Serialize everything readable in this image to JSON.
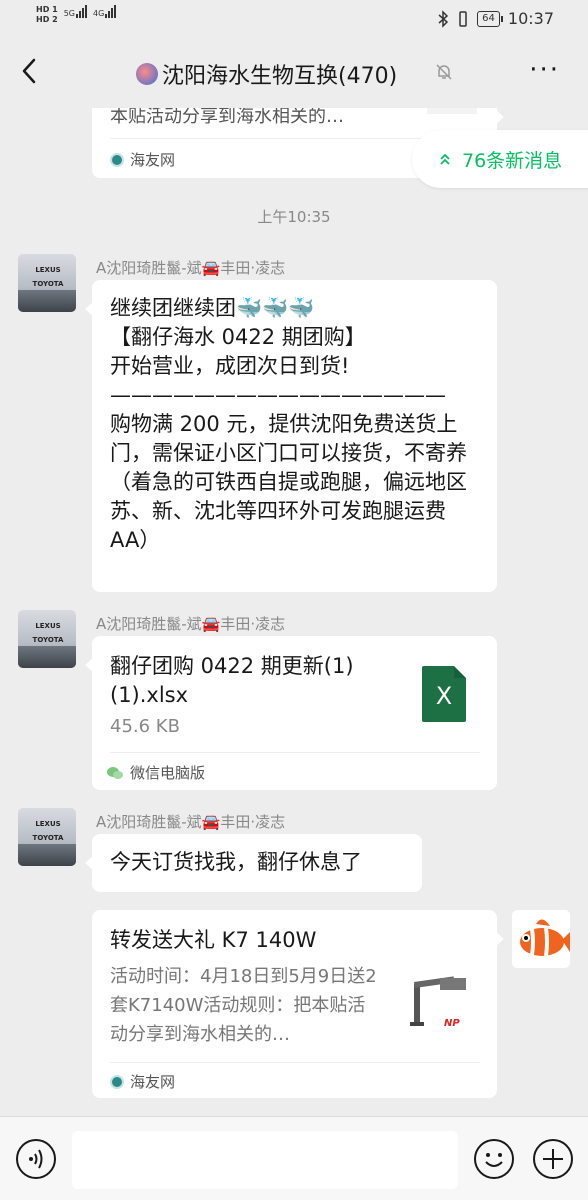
{
  "status_bar": {
    "hd1": "HD 1",
    "hd2": "HD 2",
    "net1": "5G",
    "net2": "4G",
    "battery": "64",
    "time": "10:37"
  },
  "header": {
    "title": "沈阳海水生物互换(470)",
    "more_label": "···"
  },
  "new_messages": {
    "label": "76条新消息"
  },
  "messages": [
    {
      "kind": "link-partial",
      "text": "本贴活动分享到海水相关的…",
      "source": "海友网"
    },
    {
      "kind": "time",
      "text": "上午10:35"
    },
    {
      "kind": "text",
      "sender": "A沈阳琦胜鬣-斌🚘丰田·凌志",
      "text": "继续团继续团🐳🐳🐳\n【翻仔海水 0422 期团购】\n开始营业，成团次日到货!\n————————————————\n购物满 200 元，提供沈阳免费送货上门，需保证小区门口可以接货，不寄养（着急的可铁西自提或跑腿，偏远地区苏、新、沈北等四环外可发跑腿运费 AA）"
    },
    {
      "kind": "file",
      "sender": "A沈阳琦胜鬣-斌🚘丰田·凌志",
      "filename": "翻仔团购 0422 期更新(1)(1).xlsx",
      "size": "45.6 KB",
      "file_icon_label": "X",
      "source": "微信电脑版"
    },
    {
      "kind": "text",
      "sender": "A沈阳琦胜鬣-斌🚘丰田·凌志",
      "text": "今天订货找我，翻仔休息了"
    },
    {
      "kind": "link",
      "title": "转发送大礼 K7 140W",
      "desc": "活动时间：4月18日到5月9日送2套K7140W活动规则：把本贴活动分享到海水相关的…",
      "source": "海友网",
      "thumb_label": "NP"
    }
  ],
  "avatar_brand": {
    "top": "LEXUS",
    "bottom": "TOYOTA"
  },
  "icons": {
    "back": "back-arrow-icon",
    "mute": "mute-bell-icon",
    "voice": "voice-icon",
    "emoji": "emoji-icon",
    "plus": "plus-icon"
  },
  "colors": {
    "accent": "#07c160",
    "background": "#ededed",
    "bubble": "#ffffff",
    "excel": "#1d7044"
  }
}
